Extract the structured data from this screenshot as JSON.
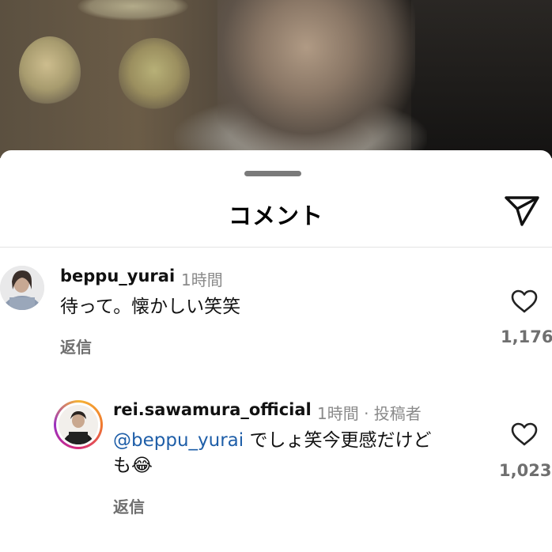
{
  "sheet": {
    "title": "コメント"
  },
  "comments": [
    {
      "username": "beppu_yurai",
      "time": "1時間",
      "text": "待って。懐かしい笑笑",
      "reply_label": "返信",
      "likes": "1,176"
    }
  ],
  "replies": [
    {
      "username": "rei.sawamura_official",
      "time": "1時間 · 投稿者",
      "mention": "@beppu_yurai",
      "text_line1": " でしょ笑今更感だけど",
      "text_line2": "も",
      "emoji": "😂",
      "reply_label": "返信",
      "likes": "1,023"
    }
  ],
  "icons": {
    "send": "paper-plane-icon",
    "like": "heart-outline-icon"
  }
}
